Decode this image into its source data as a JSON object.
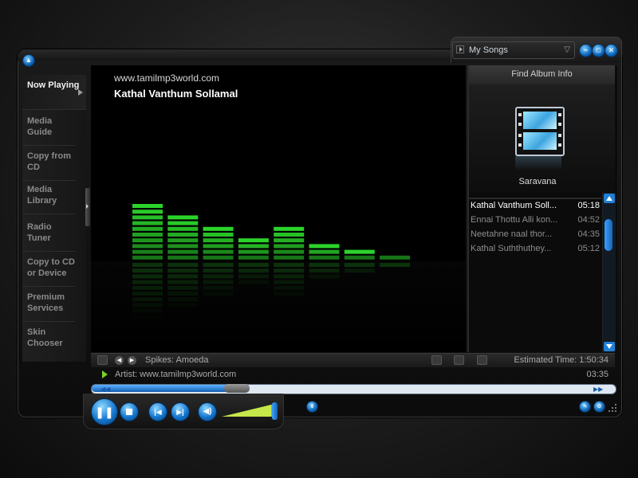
{
  "title_bar": {
    "library_label": "My Songs",
    "window_buttons": [
      "minimize-icon",
      "restore-icon",
      "close-icon"
    ]
  },
  "sidebar": {
    "items": [
      {
        "label": "Now Playing",
        "active": true
      },
      {
        "label": "Media Guide",
        "active": false
      },
      {
        "label": "Copy from CD",
        "active": false
      },
      {
        "label": "Media Library",
        "active": false
      },
      {
        "label": "Radio Tuner",
        "active": false
      },
      {
        "label": "Copy to CD or Device",
        "active": false
      },
      {
        "label": "Premium Services",
        "active": false
      },
      {
        "label": "Skin Chooser",
        "active": false
      }
    ]
  },
  "now_playing": {
    "site": "www.tamilmp3world.com",
    "track_title": "Kathal Vanthum Sollamal"
  },
  "visualization": {
    "name": "Spikes: Amoeda",
    "bar_segments": [
      10,
      8,
      6,
      4,
      6,
      3,
      2,
      1
    ],
    "bar_color": "#2bd42b"
  },
  "album": {
    "find_label": "Find Album Info",
    "name": "Saravana"
  },
  "playlist": {
    "tracks": [
      {
        "title": "Kathal Vanthum Soll...",
        "duration": "05:18",
        "current": true
      },
      {
        "title": "Ennai Thottu Alli kon...",
        "duration": "04:52",
        "current": false
      },
      {
        "title": "Neetahne naal thor...",
        "duration": "04:35",
        "current": false
      },
      {
        "title": "Kathal Suththuthey...",
        "duration": "05:12",
        "current": false
      }
    ]
  },
  "status": {
    "estimated_time": "Estimated Time: 1:50:34",
    "artist": "Artist: www.tamilmp3world.com",
    "elapsed": "03:35"
  },
  "seek": {
    "progress_fraction": 0.28
  },
  "volume": {
    "level_fraction": 0.95
  },
  "colors": {
    "accent": "#1577d0",
    "viz_green": "#2bd42b"
  }
}
